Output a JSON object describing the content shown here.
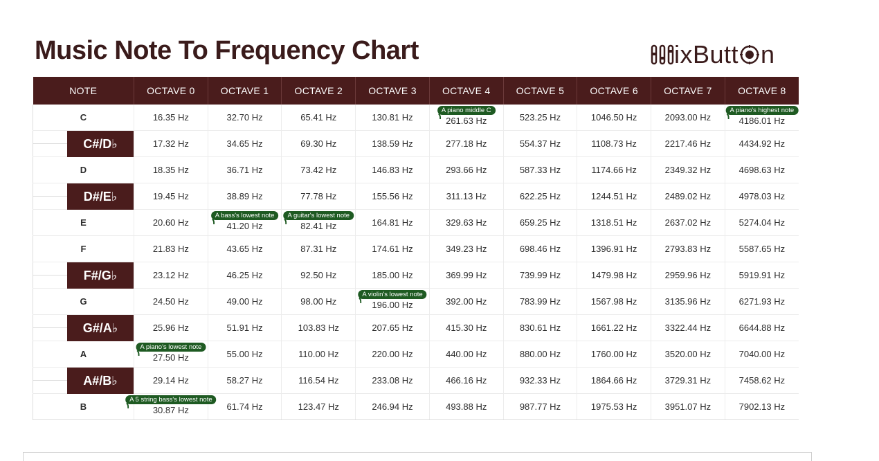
{
  "title": "Music Note To Frequency Chart",
  "logo": {
    "text": "MixButton",
    "m_glyph": "M",
    "o_glyph": "o",
    "pre": "ixButt",
    "post": "n"
  },
  "colors": {
    "header_bg": "#4a1c1c",
    "tag_bg": "#1e5a22",
    "title": "#3a1b1b"
  },
  "table": {
    "headers": [
      "NOTE",
      "OCTAVE 0",
      "OCTAVE 1",
      "OCTAVE 2",
      "OCTAVE 3",
      "OCTAVE 4",
      "OCTAVE 5",
      "OCTAVE 6",
      "OCTAVE 7",
      "OCTAVE 8"
    ],
    "rows": [
      {
        "note": "C",
        "sharp": false,
        "cells": [
          "16.35 Hz",
          "32.70 Hz",
          "65.41 Hz",
          "130.81 Hz",
          "261.63 Hz",
          "523.25 Hz",
          "1046.50 Hz",
          "2093.00 Hz",
          "4186.01 Hz"
        ]
      },
      {
        "note": "C#/D♭",
        "sharp": true,
        "cells": [
          "17.32 Hz",
          "34.65 Hz",
          "69.30 Hz",
          "138.59 Hz",
          "277.18 Hz",
          "554.37 Hz",
          "1108.73 Hz",
          "2217.46 Hz",
          "4434.92 Hz"
        ]
      },
      {
        "note": "D",
        "sharp": false,
        "cells": [
          "18.35 Hz",
          "36.71 Hz",
          "73.42 Hz",
          "146.83 Hz",
          "293.66 Hz",
          "587.33 Hz",
          "1174.66 Hz",
          "2349.32 Hz",
          "4698.63 Hz"
        ]
      },
      {
        "note": "D#/E♭",
        "sharp": true,
        "cells": [
          "19.45 Hz",
          "38.89 Hz",
          "77.78 Hz",
          "155.56 Hz",
          "311.13 Hz",
          "622.25 Hz",
          "1244.51 Hz",
          "2489.02 Hz",
          "4978.03 Hz"
        ]
      },
      {
        "note": "E",
        "sharp": false,
        "cells": [
          "20.60 Hz",
          "41.20 Hz",
          "82.41 Hz",
          "164.81 Hz",
          "329.63 Hz",
          "659.25 Hz",
          "1318.51 Hz",
          "2637.02 Hz",
          "5274.04 Hz"
        ]
      },
      {
        "note": "F",
        "sharp": false,
        "cells": [
          "21.83 Hz",
          "43.65 Hz",
          "87.31 Hz",
          "174.61 Hz",
          "349.23 Hz",
          "698.46 Hz",
          "1396.91 Hz",
          "2793.83 Hz",
          "5587.65 Hz"
        ]
      },
      {
        "note": "F#/G♭",
        "sharp": true,
        "cells": [
          "23.12 Hz",
          "46.25 Hz",
          "92.50 Hz",
          "185.00 Hz",
          "369.99 Hz",
          "739.99 Hz",
          "1479.98 Hz",
          "2959.96 Hz",
          "5919.91 Hz"
        ]
      },
      {
        "note": "G",
        "sharp": false,
        "cells": [
          "24.50 Hz",
          "49.00 Hz",
          "98.00 Hz",
          "196.00 Hz",
          "392.00 Hz",
          "783.99 Hz",
          "1567.98 Hz",
          "3135.96 Hz",
          "6271.93 Hz"
        ]
      },
      {
        "note": "G#/A♭",
        "sharp": true,
        "cells": [
          "25.96 Hz",
          "51.91 Hz",
          "103.83 Hz",
          "207.65 Hz",
          "415.30 Hz",
          "830.61 Hz",
          "1661.22 Hz",
          "3322.44 Hz",
          "6644.88 Hz"
        ]
      },
      {
        "note": "A",
        "sharp": false,
        "cells": [
          "27.50 Hz",
          "55.00 Hz",
          "110.00 Hz",
          "220.00 Hz",
          "440.00 Hz",
          "880.00 Hz",
          "1760.00 Hz",
          "3520.00 Hz",
          "7040.00 Hz"
        ]
      },
      {
        "note": "A#/B♭",
        "sharp": true,
        "cells": [
          "29.14 Hz",
          "58.27 Hz",
          "116.54 Hz",
          "233.08 Hz",
          "466.16 Hz",
          "932.33 Hz",
          "1864.66 Hz",
          "3729.31 Hz",
          "7458.62 Hz"
        ]
      },
      {
        "note": "B",
        "sharp": false,
        "cells": [
          "30.87 Hz",
          "61.74 Hz",
          "123.47 Hz",
          "246.94 Hz",
          "493.88 Hz",
          "987.77 Hz",
          "1975.53 Hz",
          "3951.07 Hz",
          "7902.13 Hz"
        ]
      }
    ],
    "annotations": [
      {
        "row": 0,
        "col": 4,
        "text": "A piano middle C"
      },
      {
        "row": 0,
        "col": 8,
        "text": "A piano's highest note"
      },
      {
        "row": 4,
        "col": 1,
        "text": "A bass's lowest note"
      },
      {
        "row": 4,
        "col": 2,
        "text": "A guitar's lowest note"
      },
      {
        "row": 7,
        "col": 3,
        "text": "A violin's lowest note"
      },
      {
        "row": 9,
        "col": 0,
        "text": "A piano's lowest note"
      },
      {
        "row": 11,
        "col": 0,
        "text": "A 5 string bass's lowest note"
      }
    ]
  }
}
